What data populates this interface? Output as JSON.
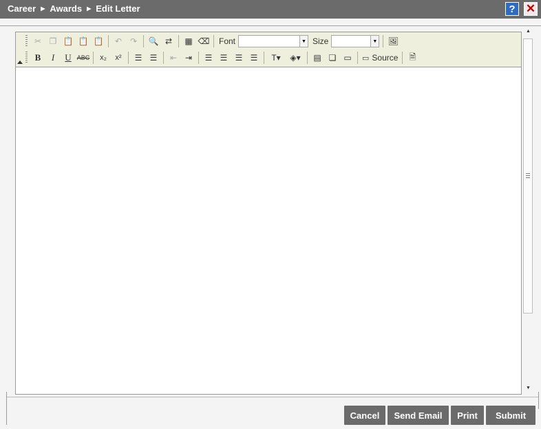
{
  "header": {
    "breadcrumbs": [
      "Career",
      "Awards",
      "Edit Letter"
    ],
    "help_icon": "?",
    "close_icon": "✕"
  },
  "toolbar": {
    "font_label": "Font",
    "font_value": "",
    "size_label": "Size",
    "size_value": "",
    "source_label": "Source",
    "superscript_glyph": "x²",
    "subscript_glyph": "x₂",
    "strike_glyph": "ABC"
  },
  "editor": {
    "content": ""
  },
  "footer": {
    "cancel": "Cancel",
    "send_email": "Send Email",
    "print": "Print",
    "submit": "Submit"
  }
}
